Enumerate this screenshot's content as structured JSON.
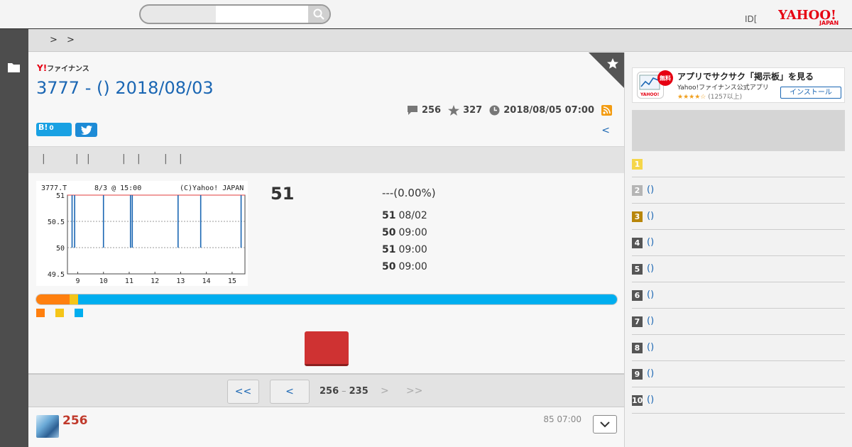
{
  "header": {
    "search_placeholder": "",
    "id_text": "ID[",
    "help_text": "]",
    "logo_main": "YAHOO!",
    "logo_sub": "JAPAN"
  },
  "breadcrumb": {
    "sep1": ">",
    "sep2": ">"
  },
  "post": {
    "finance_logo_y": "Y!",
    "finance_logo_text": "ファイナンス",
    "title": "3777 - () 2018/08/03",
    "comment_count": "256",
    "star_count": "327",
    "timestamp": "2018/08/05 07:00",
    "hatena_label": "B!",
    "hatena_count": "0",
    "back_link": "<"
  },
  "tabs": {
    "dividers": [
      "|",
      "|",
      "|",
      "|",
      "|",
      "|",
      "|"
    ]
  },
  "chart_data": {
    "type": "line",
    "ticker_label": "3777.T",
    "date_label": "8/3 @ 15:00",
    "credit": "(C)Yahoo! JAPAN",
    "x_ticks": [
      "9",
      "10",
      "11",
      "12",
      "13",
      "14",
      "15"
    ],
    "y_ticks": [
      "51",
      "50.5",
      "50",
      "49.5"
    ],
    "ylim": [
      49.5,
      51
    ],
    "xlim": [
      8.6,
      15.5
    ],
    "baseline": 51,
    "spikes": [
      {
        "x": 8.78,
        "y": 50
      },
      {
        "x": 8.88,
        "y": 50
      },
      {
        "x": 10.0,
        "y": 50
      },
      {
        "x": 11.05,
        "y": 50
      },
      {
        "x": 11.12,
        "y": 50
      },
      {
        "x": 12.9,
        "y": 50
      },
      {
        "x": 13.78,
        "y": 50
      },
      {
        "x": 15.35,
        "y": 50
      }
    ]
  },
  "stock": {
    "price": "51",
    "change": "---(0.00%)",
    "rows": [
      {
        "value": "51",
        "label": "08/02"
      },
      {
        "value": "50",
        "label": "09:00"
      },
      {
        "value": "51",
        "label": "09:00"
      },
      {
        "value": "50",
        "label": "09:00"
      }
    ]
  },
  "sentiment": {
    "segments": [
      {
        "share": 0.058,
        "color": "#ff7f0e"
      },
      {
        "share": 0.014,
        "color": "#f5c518"
      },
      {
        "share": 0.928,
        "color": "#00aeef"
      }
    ]
  },
  "pager": {
    "first": "<<",
    "prev": "<",
    "range_start": "256",
    "range_dash": "–",
    "range_end": "235",
    "next": ">",
    "last": ">>"
  },
  "comment": {
    "number": "256",
    "time": "85 07:00"
  },
  "ad": {
    "badge": "無料",
    "title": "アプリでサクサク「掲示板」を見る",
    "subtitle": "Yahoo!ファイナンス公式アプリ",
    "stars": "★★★★☆",
    "review_count": "(1257以上)",
    "install": "インストール"
  },
  "ranking": [
    {
      "rank": "1",
      "label": "",
      "color": "#f5d64a"
    },
    {
      "rank": "2",
      "label": "()",
      "color": "#b5b5b5"
    },
    {
      "rank": "3",
      "label": "()",
      "color": "#b8860b"
    },
    {
      "rank": "4",
      "label": "()",
      "color": "#555555"
    },
    {
      "rank": "5",
      "label": "()",
      "color": "#555555"
    },
    {
      "rank": "6",
      "label": "()",
      "color": "#555555"
    },
    {
      "rank": "7",
      "label": "()",
      "color": "#555555"
    },
    {
      "rank": "8",
      "label": "()",
      "color": "#555555"
    },
    {
      "rank": "9",
      "label": "()",
      "color": "#555555"
    },
    {
      "rank": "10",
      "label": "()",
      "color": "#555555"
    }
  ]
}
